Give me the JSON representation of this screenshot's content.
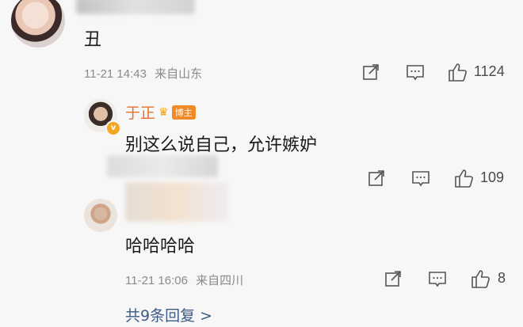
{
  "comment": {
    "text": "丑",
    "date": "11-21 14:43",
    "location": "来自山东",
    "like_count": "1124"
  },
  "replies": [
    {
      "username": "于正",
      "badge": "博主",
      "text": "别这么说自己，允许嫉妒",
      "like_count": "109"
    },
    {
      "text": "哈哈哈哈",
      "date": "11-21 16:06",
      "location": "来自四川",
      "like_count": "8"
    }
  ],
  "more_replies_label": "共9条回复 >",
  "icons": {
    "share": "share-icon",
    "comment": "comment-icon",
    "like": "thumbs-up-icon"
  },
  "colors": {
    "username": "#e8702a",
    "badge": "#f08a27",
    "link": "#3d5a86",
    "meta": "#8a8a8a"
  }
}
